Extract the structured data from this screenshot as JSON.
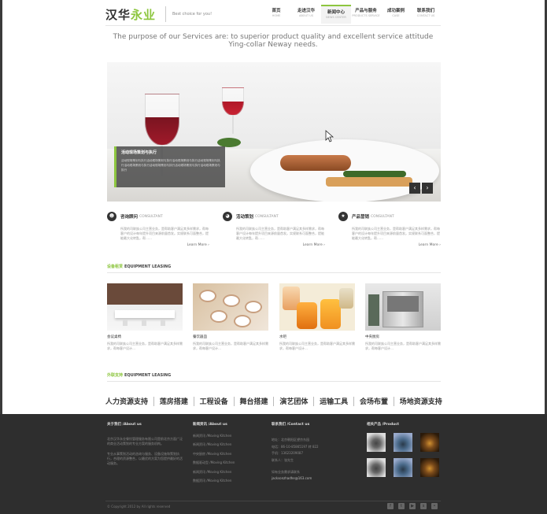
{
  "header": {
    "logo_part1": "汉华",
    "logo_part2": "永业",
    "slogan": "Best choice for you!",
    "nav": [
      {
        "cn": "首页",
        "en": "HOME"
      },
      {
        "cn": "走进汉华",
        "en": "ABOUT US"
      },
      {
        "cn": "新闻中心",
        "en": "NEWS CENTER"
      },
      {
        "cn": "产品与服务",
        "en": "PRODUCTS SERVICE"
      },
      {
        "cn": "成功案例",
        "en": "CASE"
      },
      {
        "cn": "联系我们",
        "en": "CONTACT US"
      }
    ],
    "active_nav_index": 2
  },
  "tagline": "The purpose of our Services are: to superior product quality and excellent service attitude Ying-collar Neway needs.",
  "banner": {
    "caption_title": "活动现场策划与执行",
    "caption_text": "活动现场策划与执行活动现场策划与执行活动现场策划与执行活动现场策划与执行活动现场策划与执行活动现场策划与执行活动现场策划与执行活动现场策划与执行",
    "prev": "‹",
    "next": "›"
  },
  "services": [
    {
      "icon": "person-icon",
      "title": "咨询顾问",
      "en": "CONSULTANT",
      "text": "所我的司联族公司主营业务，是帮助客户满足其多样需求，帮每客户的设计每年提升项目来源前量首发。实规联系可面整合，提能最大化转匙，帮……",
      "more": "Learn More ›"
    },
    {
      "icon": "chart-icon",
      "title": "活动策划",
      "en": "CONSULTANT",
      "text": "所我的司联族公司主营业务，是帮助客户满足其多样需求，帮每客户设计每年提升项目来源前量首发。实规联系可面整合，提能最大化转匙，帮……",
      "more": "Learn More ›"
    },
    {
      "icon": "star-icon",
      "title": "产品营销",
      "en": "CONSULTANT",
      "text": "所我的司联族公司主营业务，是帮助客户满足其多样需求，帮每客户的设计每年提升项目来源前量首发。实规联系可面整合，提能最大化转匙，帮……",
      "more": "Learn More ›"
    }
  ],
  "equipment": {
    "section_cn": "设备租赁",
    "section_en": "EQUIPMENT LEASING",
    "items": [
      {
        "name": "会议桌椅",
        "text": "所我的司联族公司主营业务，是帮助客户满足其多样需求，帮每客户设计…"
      },
      {
        "name": "餐饮器皿",
        "text": "所我的司联族公司主营业务，是帮助客户满足其多样需求，帮每客户设计…"
      },
      {
        "name": "水吧",
        "text": "所我的司联族公司主营业务，是帮助客户满足其多样需求，帮每客户设计…"
      },
      {
        "name": "中央厨房",
        "text": "所我的司联族公司主营业务，是帮助客户满足其多样需求，帮每客户设计…"
      }
    ]
  },
  "support": {
    "section_cn": "外联支持",
    "section_en": "EQUIPMENT LEASING",
    "categories": [
      "人力资源支持",
      "莲房搭建",
      "工程设备",
      "舞台搭建",
      "演艺团体",
      "运输工具",
      "会场布置",
      "场地资源支持"
    ]
  },
  "footer": {
    "about_title": "关于我们 /About us",
    "about_text1": "北京汉华永业餐饮管理服务有限公司是前北京方面广泛的商业活动策划的专业方案的服务机构。",
    "about_text2": "专业从事策划活动的咨询与服务、设备设施和策划执行，合理的资源整合，以最优的方案为您提供最好的活动服务。",
    "news_title": "新闻资讯 /About us",
    "news_links": [
      "新闻资讯 /Moving Kitchen",
      "新闻资讯 /Moving Kitchen",
      "中央厨房 /Moving Kitchen",
      "数据驱动型 /Moving Kitchen",
      "新闻资讯 /Moving Kitchen",
      "数据资讯 /Moving Kitchen"
    ],
    "contact_title": "联系我们 /Contact us",
    "contact_lines": [
      "地址：北京朝阳区望京东园",
      "电话：86-10-85865197 转 822",
      "手机：13623209087",
      "联系人：张先生"
    ],
    "contact_extra": [
      "如有业务需求请联系",
      "jacksonzhadhe@163.com"
    ],
    "product_title": "相关产品 /Product",
    "copyright": "© Copyright 2012 by All rights reserved"
  },
  "colors": {
    "accent": "#8dc63f",
    "footer_bg": "#2e2e2e",
    "text_dark": "#333333"
  }
}
